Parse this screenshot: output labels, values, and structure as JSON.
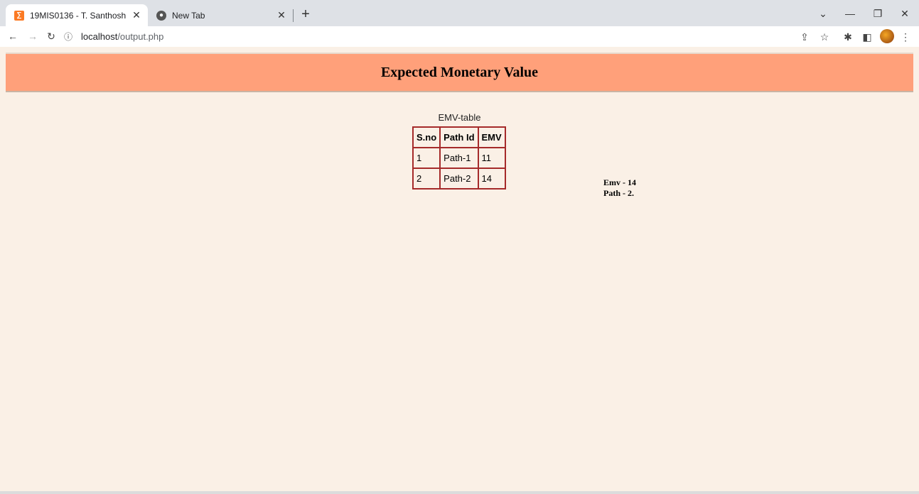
{
  "browser": {
    "tabs": [
      {
        "title": "19MIS0136 - T. Santhosh",
        "icon": "xampp-icon",
        "active": true
      },
      {
        "title": "New Tab",
        "icon": "chrome-icon",
        "active": false
      }
    ],
    "url_host": "localhost",
    "url_path": "/output.php",
    "colors": {
      "tabstrip": "#dee1e6",
      "favicon_xampp": "#fb7a24"
    }
  },
  "page": {
    "heading": "Expected Monetary Value",
    "table": {
      "caption": "EMV-table",
      "headers": [
        "S.no",
        "Path Id",
        "EMV"
      ],
      "rows": [
        [
          "1",
          "Path-1",
          "11"
        ],
        [
          "2",
          "Path-2",
          "14"
        ]
      ]
    },
    "result": {
      "emv_line": "Emv - 14",
      "path_line": "Path - 2."
    },
    "colors": {
      "background": "#faf0e6",
      "header": "#ffa07a",
      "table_border": "#a52a2a"
    }
  }
}
